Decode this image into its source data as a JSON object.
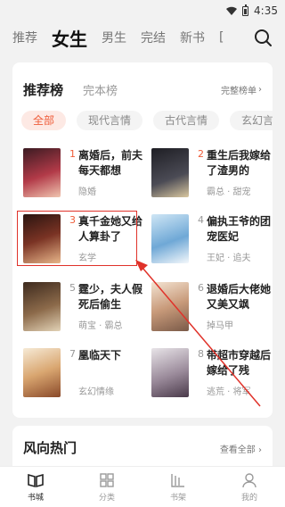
{
  "status": {
    "time": "4:35"
  },
  "topnav": {
    "tabs": [
      {
        "label": "推荐"
      },
      {
        "label": "女生"
      },
      {
        "label": "男生"
      },
      {
        "label": "完结"
      },
      {
        "label": "新书"
      },
      {
        "label": "["
      }
    ]
  },
  "ranking": {
    "title": "推荐榜",
    "subtitle": "完本榜",
    "more": "完整榜单",
    "chips": [
      "全部",
      "现代言情",
      "古代言情",
      "玄幻言"
    ],
    "books": [
      {
        "rank": "1",
        "title": "离婚后，前夫每天都想",
        "tag": "隐婚"
      },
      {
        "rank": "2",
        "title": "重生后我嫁给了渣男的",
        "tag": "霸总 · 甜宠"
      },
      {
        "rank": "3",
        "title": "真千金她又给人算卦了",
        "tag": "玄学"
      },
      {
        "rank": "4",
        "title": "偏执王爷的团宠医妃",
        "tag": "王妃 · 追夫"
      },
      {
        "rank": "5",
        "title": "霆少，夫人假死后偷生",
        "tag": "萌宝 · 霸总"
      },
      {
        "rank": "6",
        "title": "退婚后大佬她又美又飒",
        "tag": "掉马甲"
      },
      {
        "rank": "7",
        "title": "凰临天下",
        "tag": "玄幻情缘"
      },
      {
        "rank": "8",
        "title": "带超市穿越后嫁给了残",
        "tag": "逃荒 · 将军"
      }
    ]
  },
  "section2": {
    "title": "风向热门",
    "more": "查看全部 ›"
  },
  "bottombar": {
    "items": [
      "书城",
      "分类",
      "书架",
      "我的"
    ]
  },
  "colors": {
    "accent": "#ef5d3a",
    "highlight": "#e0322a"
  }
}
